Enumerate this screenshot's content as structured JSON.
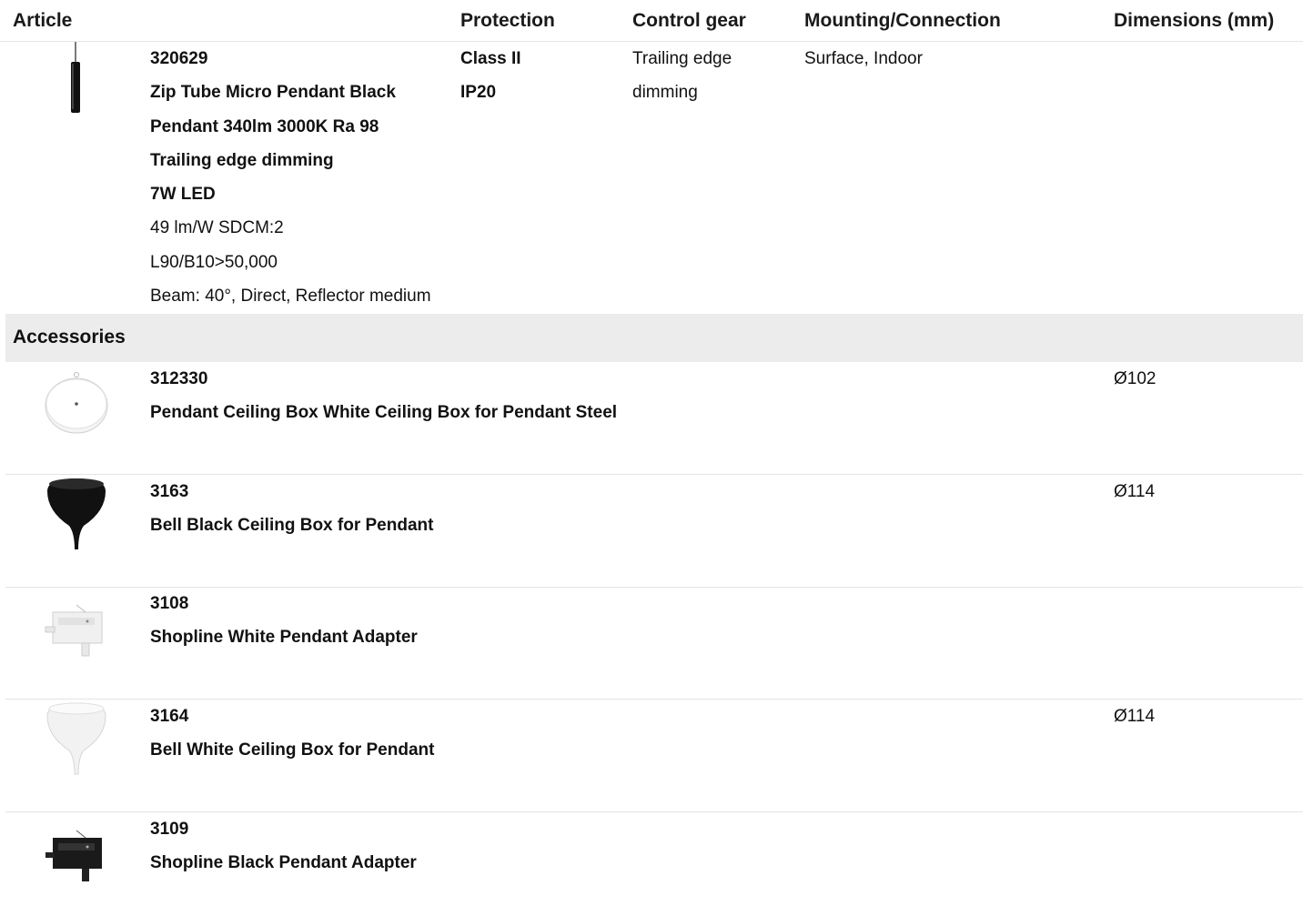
{
  "header": {
    "article": "Article",
    "protection": "Protection",
    "control_gear": "Control gear",
    "mounting": "Mounting/Connection",
    "dimensions": "Dimensions (mm)"
  },
  "main": {
    "number": "320629",
    "name": "Zip Tube Micro Pendant Black",
    "spec": "Pendant 340lm 3000K Ra 98",
    "dimming": "Trailing edge dimming",
    "power": "7W LED",
    "efficacy": "49 lm/W SDCM:2",
    "lifetime": "L90/B10>50,000",
    "beam": "Beam: 40°, Direct, Reflector medium",
    "protection_class": "Class II",
    "protection_ip": "IP20",
    "control_gear_1": "Trailing edge",
    "control_gear_2": "dimming",
    "mounting": "Surface, Indoor",
    "dimensions": ""
  },
  "accessories": {
    "title": "Accessories",
    "items": [
      {
        "number": "312330",
        "name": "Pendant Ceiling Box White Ceiling Box for Pendant Steel",
        "dimensions": "Ø102",
        "icon": "white-ceiling-box-icon"
      },
      {
        "number": "3163",
        "name": "Bell Black Ceiling Box for Pendant",
        "dimensions": "Ø114",
        "icon": "black-bell-icon"
      },
      {
        "number": "3108",
        "name": "Shopline White Pendant Adapter",
        "dimensions": "",
        "icon": "white-adapter-icon"
      },
      {
        "number": "3164",
        "name": "Bell White Ceiling Box for Pendant",
        "dimensions": "Ø114",
        "icon": "white-bell-icon"
      },
      {
        "number": "3109",
        "name": "Shopline Black Pendant Adapter",
        "dimensions": "",
        "icon": "black-adapter-icon"
      }
    ]
  }
}
